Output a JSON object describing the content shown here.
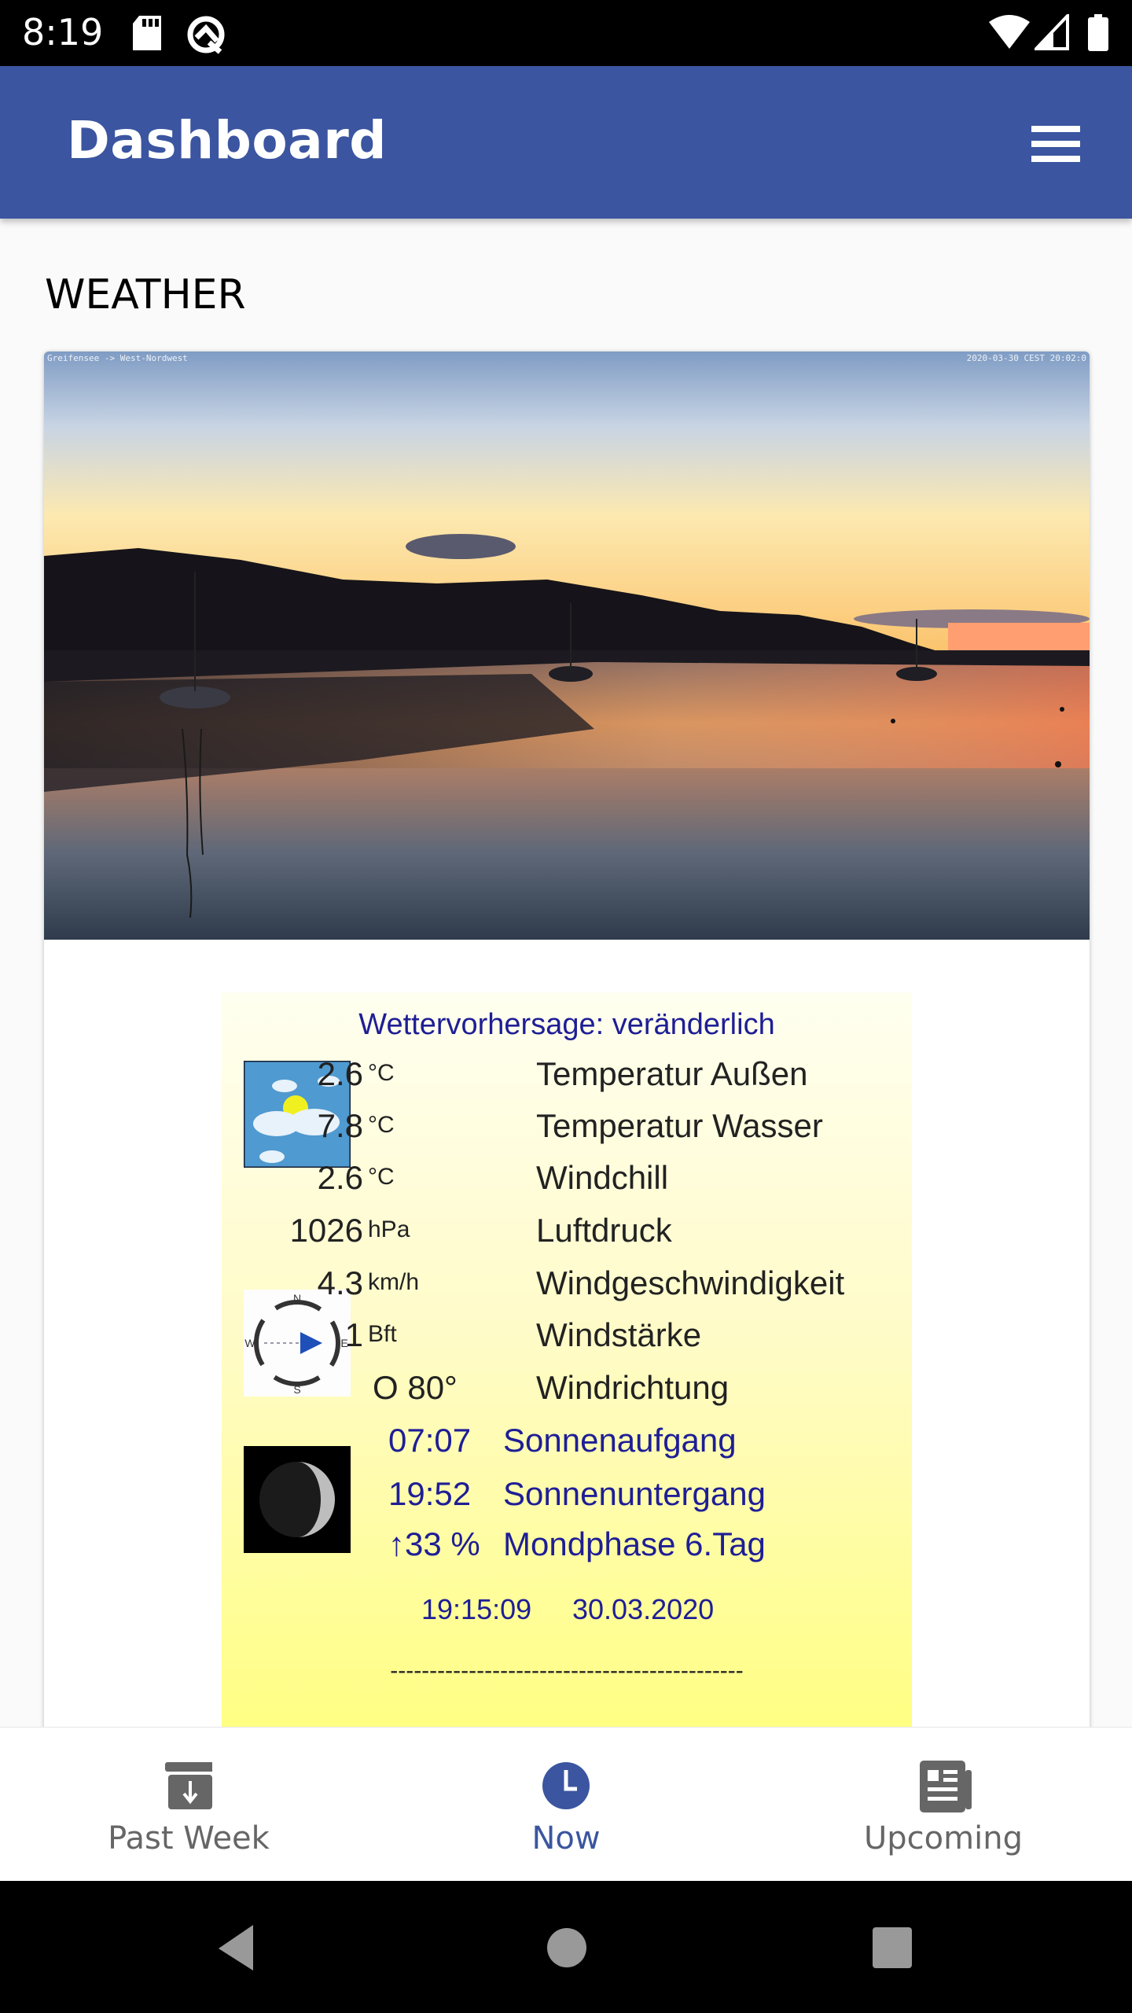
{
  "status_bar": {
    "time": "8:19",
    "icons": [
      "sd-card-icon",
      "q-logo-icon",
      "wifi-icon",
      "cell-signal-icon",
      "battery-icon"
    ]
  },
  "app_bar": {
    "title": "Dashboard",
    "menu_icon": "hamburger-menu-icon"
  },
  "section": {
    "title": "WEATHER"
  },
  "webcam": {
    "overlay_left": "Greifensee -> West-Nordwest",
    "overlay_right": "2020-03-30 CEST 20:02:0"
  },
  "weather_panel": {
    "header": "Wettervorhersage: veränderlich",
    "rows": [
      {
        "value": "2.6",
        "unit": "°C",
        "label": "Temperatur Außen"
      },
      {
        "value": "7.8",
        "unit": "°C",
        "label": "Temperatur  Wasser"
      },
      {
        "value": "2.6",
        "unit": "°C",
        "label": "Windchill"
      },
      {
        "value": "1026",
        "unit": "hPa",
        "label": "Luftdruck"
      },
      {
        "value": "4.3",
        "unit": "km/h",
        "label": "Windgeschwindigkeit"
      },
      {
        "value": "1",
        "unit": "Bft",
        "label": "Windstärke"
      },
      {
        "value": "O 80°",
        "unit": "",
        "label": "Windrichtung"
      }
    ],
    "sun_moon": [
      {
        "value": "07:07",
        "label": "Sonnenaufgang"
      },
      {
        "value": "19:52",
        "label": "Sonnenuntergang"
      },
      {
        "value": "↑33 %",
        "label": "Mondphase 6.Tag"
      }
    ],
    "timestamp_time": "19:15:09",
    "timestamp_date": "30.03.2020",
    "separator": "---------------------------------------------",
    "compass_letters": {
      "n": "N",
      "e": "E",
      "s": "S",
      "w": "W"
    }
  },
  "bottom_nav": {
    "tabs": [
      {
        "label": "Past Week",
        "icon": "archive-download-icon",
        "active": false
      },
      {
        "label": "Now",
        "icon": "clock-icon",
        "active": true
      },
      {
        "label": "Upcoming",
        "icon": "newspaper-icon",
        "active": false
      }
    ]
  },
  "colors": {
    "primary": "#3b55a0",
    "inactive": "#666666",
    "panel_text_blue": "#1e1e96"
  }
}
